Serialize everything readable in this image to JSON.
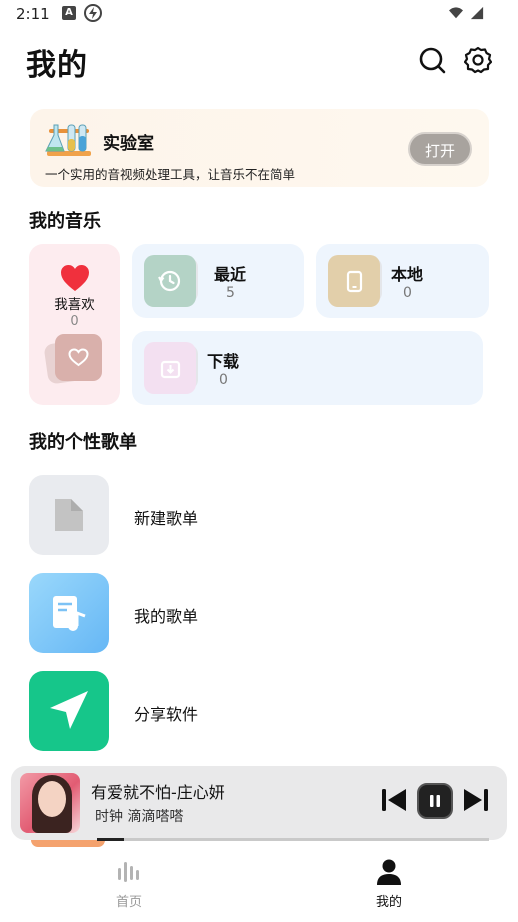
{
  "status_bar": {
    "time": "2:11",
    "badge": "A"
  },
  "header": {
    "title": "我的"
  },
  "lab": {
    "title": "实验室",
    "description": "一个实用的音视频处理工具，让音乐不在简单",
    "open_label": "打开"
  },
  "my_music": {
    "title": "我的音乐",
    "favorites": {
      "label": "我喜欢",
      "count": "0"
    },
    "recent": {
      "label": "最近",
      "count": "5"
    },
    "local": {
      "label": "本地",
      "count": "0"
    },
    "download": {
      "label": "下载",
      "count": "0"
    }
  },
  "playlists": {
    "title": "我的个性歌单",
    "items": [
      {
        "label": "新建歌单",
        "icon": "document-icon"
      },
      {
        "label": "我的歌单",
        "icon": "music-note-document-icon"
      },
      {
        "label": "分享软件",
        "icon": "send-arrow-icon"
      }
    ]
  },
  "player": {
    "song_title": "有爱就不怕-庄心妍",
    "artist_line": "时钟 滴滴嗒嗒",
    "progress": 0.07
  },
  "nav": {
    "home": "首页",
    "mine": "我的"
  },
  "colors": {
    "accent_green": "#16c68a",
    "heart_red": "#f0303d",
    "lab_button": "#a8a39e"
  }
}
